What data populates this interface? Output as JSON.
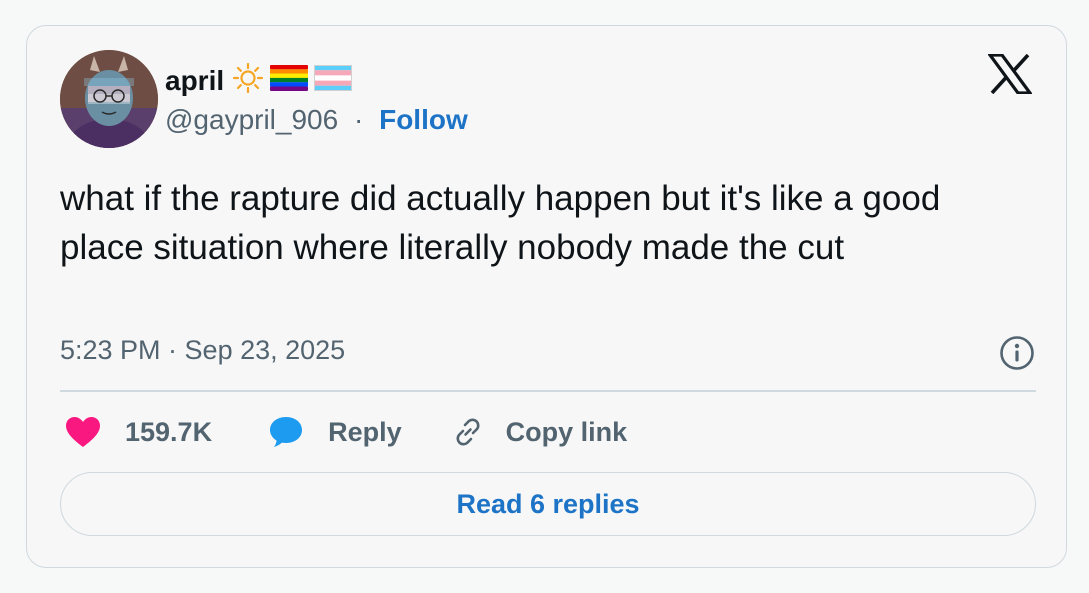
{
  "author": {
    "display_name": "april",
    "handle": "@gaypril_906",
    "separator": "·",
    "follow_label": "Follow",
    "name_emojis": [
      "sun-icon",
      "rainbow-flag-icon",
      "transgender-flag-icon"
    ]
  },
  "platform_icon": "x-logo-icon",
  "tweet": {
    "text": "what if the rapture did actually happen but it's like a good place situation where literally nobody made the cut",
    "timestamp": "5:23 PM · Sep 23, 2025"
  },
  "actions": {
    "likes_count": "159.7K",
    "reply_label": "Reply",
    "copy_link_label": "Copy link"
  },
  "read_replies_label": "Read 6 replies",
  "colors": {
    "link_blue": "#1d74c7",
    "heart": "#f91880",
    "reply_bubble": "#1d9bf0",
    "secondary_text": "#536471",
    "border": "#cfd9de"
  }
}
